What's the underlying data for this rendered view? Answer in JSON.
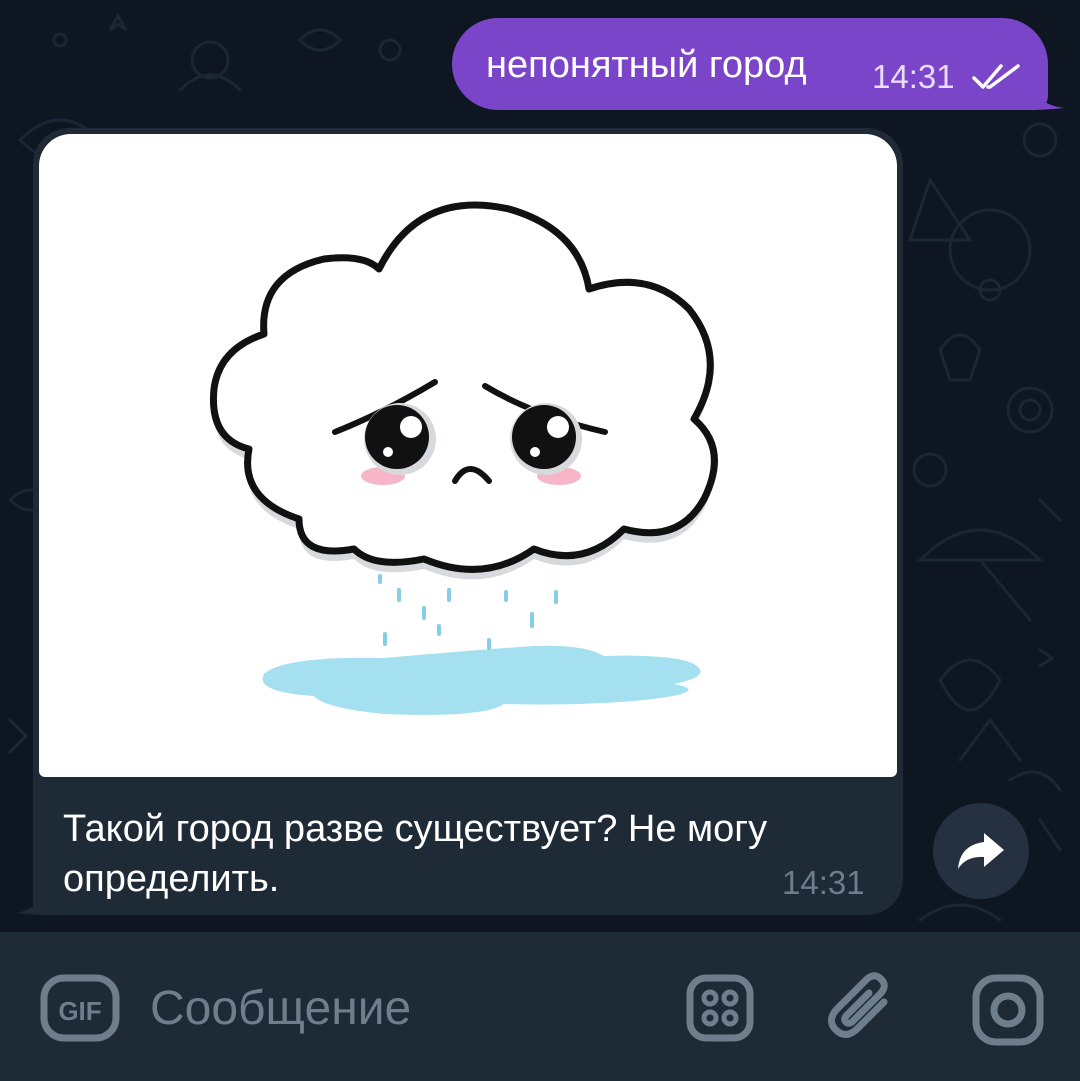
{
  "colors": {
    "chat_background": "#0e1621",
    "outgoing_bubble": "#7a45c8",
    "incoming_bubble": "#1e2a36",
    "input_bar": "#1e2a36",
    "puddle": "#a4e0f0"
  },
  "messages": {
    "outgoing": {
      "text": "непонятный город",
      "time": "14:31",
      "status_icon": "double-check-icon"
    },
    "incoming": {
      "sticker": "sad-rain-cloud",
      "text": "Такой город разве существует? Не могу определить.",
      "time": "14:31"
    }
  },
  "forward_button": {
    "icon": "forward-arrow-icon"
  },
  "composer": {
    "gif_label": "GIF",
    "placeholder": "Сообщение",
    "emoji_icon": "sticker-grid-icon",
    "attach_icon": "paperclip-icon",
    "camera_icon": "camera-circle-icon"
  }
}
